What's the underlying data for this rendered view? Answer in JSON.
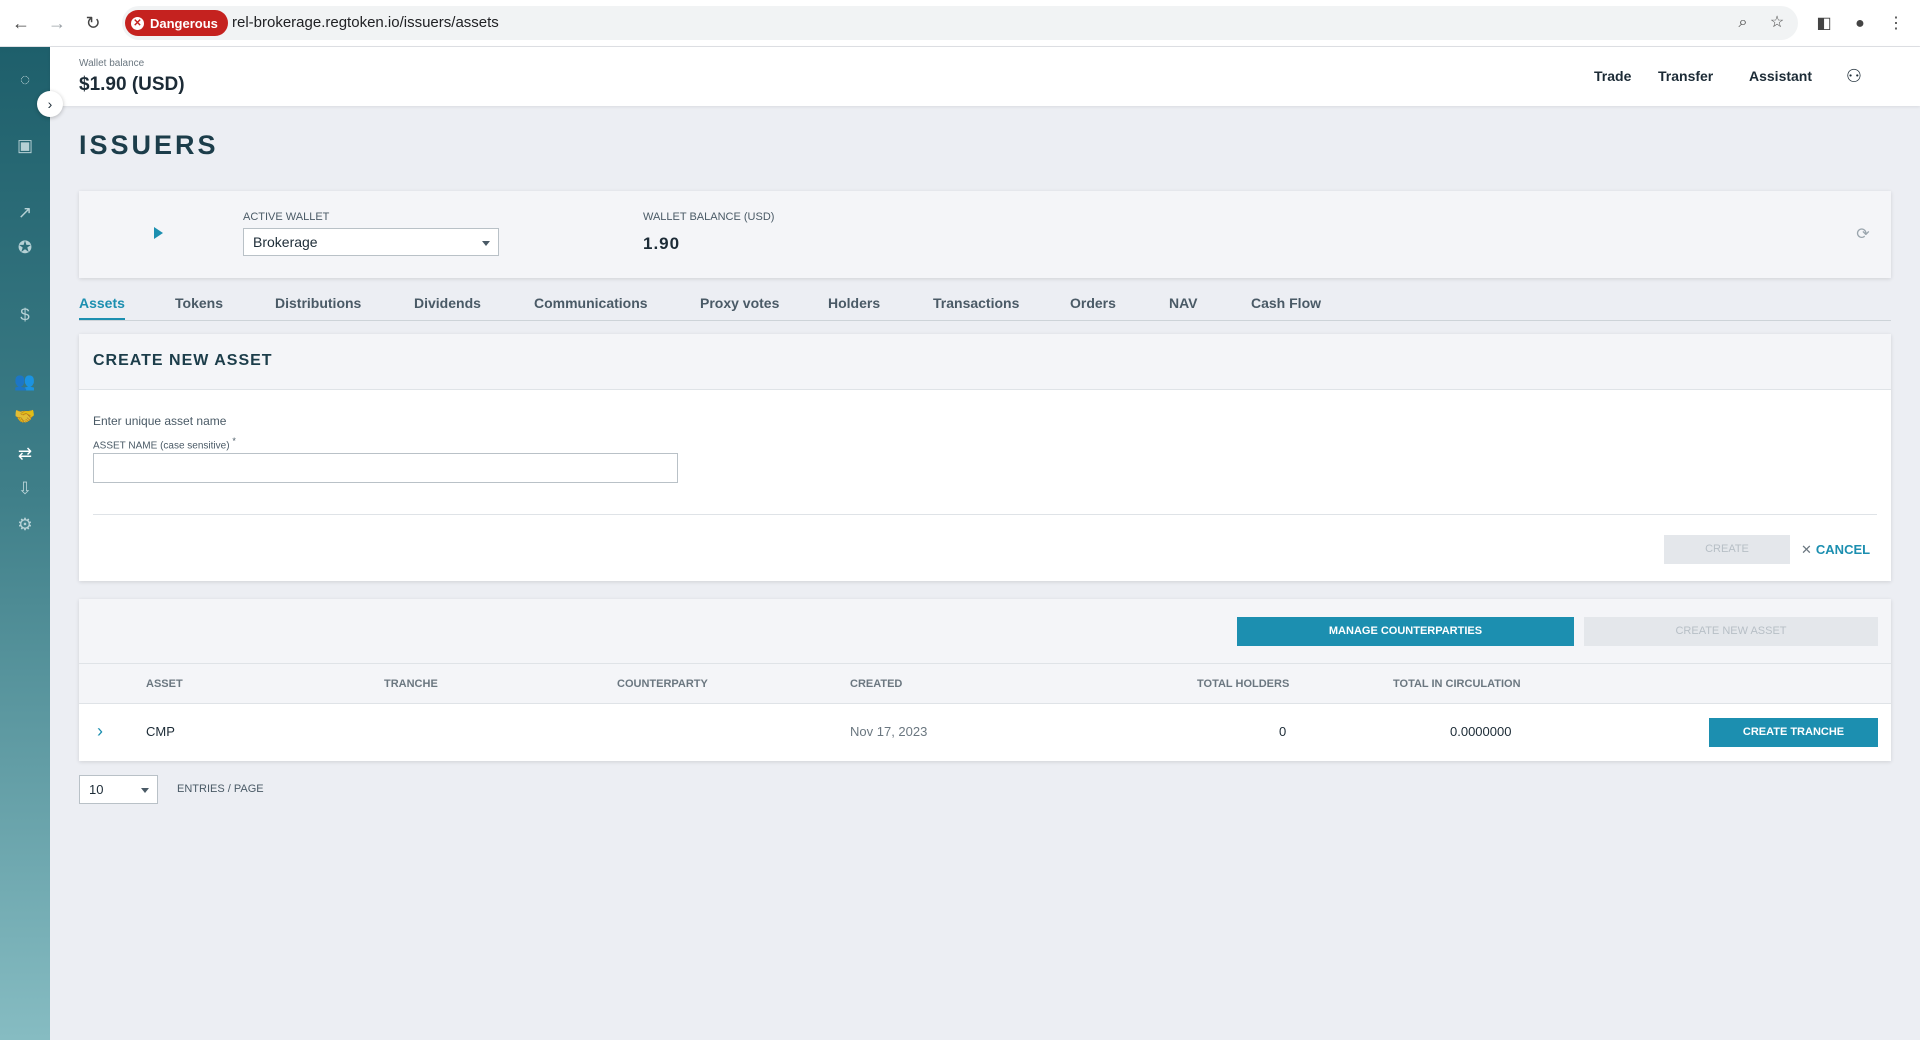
{
  "browser": {
    "security_chip": "Dangerous",
    "url": "rel-brokerage.regtoken.io/issuers/assets"
  },
  "header": {
    "wallet_balance_label": "Wallet balance",
    "wallet_balance_value": "$1.90 (USD)",
    "nav": [
      "Trade",
      "Transfer",
      "Assistant"
    ]
  },
  "page": {
    "title": "ISSUERS"
  },
  "wallet_panel": {
    "active_wallet_label": "ACTIVE WALLET",
    "active_wallet_value": "Brokerage",
    "balance_label": "WALLET BALANCE (USD)",
    "balance_value": "1.90"
  },
  "tabs": [
    "Assets",
    "Tokens",
    "Distributions",
    "Dividends",
    "Communications",
    "Proxy votes",
    "Holders",
    "Transactions",
    "Orders",
    "NAV",
    "Cash Flow"
  ],
  "create_asset": {
    "title": "CREATE NEW ASSET",
    "hint": "Enter unique asset name",
    "name_label": "ASSET NAME",
    "name_label_suffix": "(case sensitive)",
    "required_mark": "*",
    "name_value": "",
    "create_label": "CREATE",
    "cancel_label": "CANCEL"
  },
  "assets_table": {
    "manage_counterparties_label": "MANAGE COUNTERPARTIES",
    "create_new_asset_label": "CREATE NEW ASSET",
    "columns": [
      "ASSET",
      "TRANCHE",
      "COUNTERPARTY",
      "CREATED",
      "TOTAL HOLDERS",
      "TOTAL IN CIRCULATION"
    ],
    "rows": [
      {
        "asset": "CMP",
        "tranche": "",
        "counterparty": "",
        "created": "Nov 17, 2023",
        "total_holders": "0",
        "total_in_circulation": "0.0000000",
        "action_label": "CREATE TRANCHE"
      }
    ]
  },
  "pagination": {
    "page_size": "10",
    "entries_label": "ENTRIES / PAGE"
  },
  "colors": {
    "accent": "#1c8fb0",
    "danger": "#c5221f",
    "sidebar_top": "#1e5f6b",
    "sidebar_bottom": "#86bcc2"
  }
}
